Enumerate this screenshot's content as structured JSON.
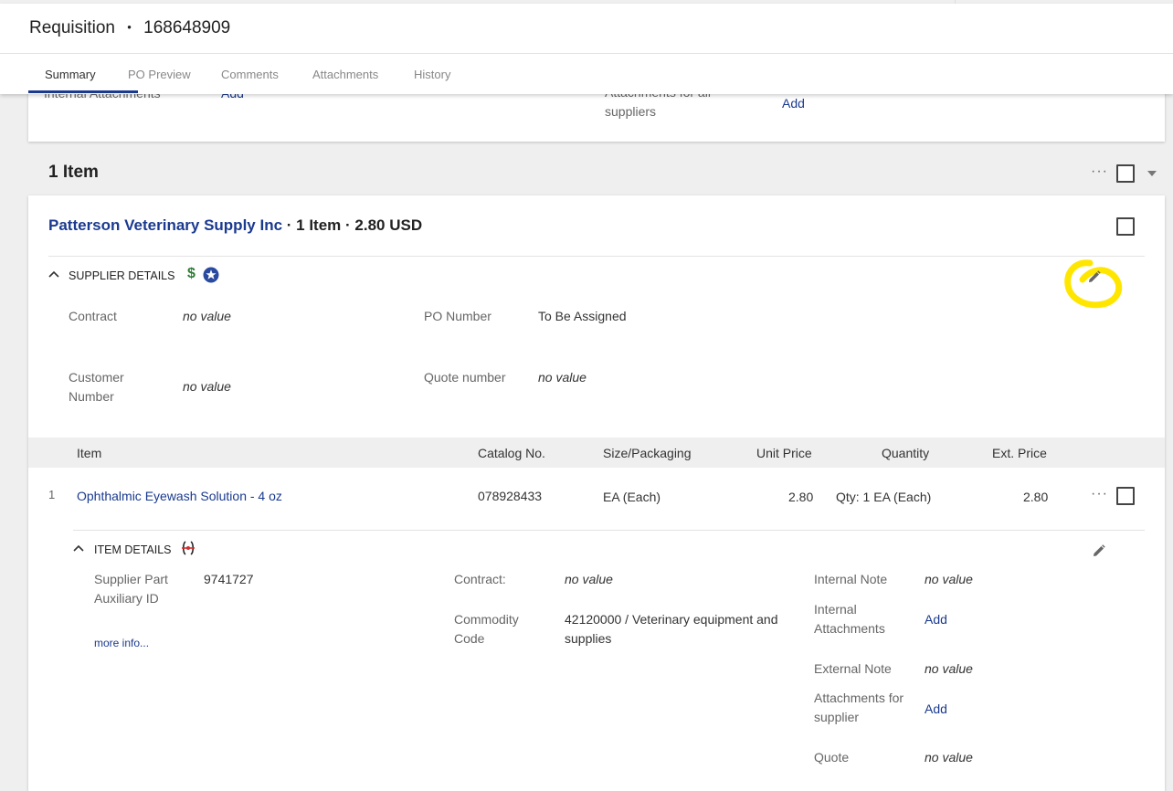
{
  "header": {
    "doc_type": "Requisition",
    "separator": "•",
    "doc_number": "168648909",
    "tabs": [
      {
        "label": "Summary",
        "active": true
      },
      {
        "label": "PO Preview",
        "active": false
      },
      {
        "label": "Comments",
        "active": false
      },
      {
        "label": "Attachments",
        "active": false
      },
      {
        "label": "History",
        "active": false
      }
    ]
  },
  "top_card": {
    "internal_attachments_label": "Internal Attachments",
    "internal_attachments_action": "Add",
    "all_suppliers_label_line1": "Attachments for all",
    "all_suppliers_label_line2": "suppliers",
    "all_suppliers_action": "Add"
  },
  "items_section": {
    "title": "1 Item",
    "more_label": "···"
  },
  "supplier": {
    "name": "Patterson Veterinary Supply Inc",
    "summary": "· 1 Item · 2.80 USD",
    "details_title": "SUPPLIER DETAILS",
    "icons": [
      "dollar-icon",
      "star-badge-icon",
      "pencil-icon"
    ],
    "fields": {
      "contract_label": "Contract",
      "contract_value": "no value",
      "po_number_label": "PO Number",
      "po_number_value": "To Be Assigned",
      "customer_number_label_line1": "Customer",
      "customer_number_label_line2": "Number",
      "customer_number_value": "no value",
      "quote_number_label": "Quote number",
      "quote_number_value": "no value"
    }
  },
  "table": {
    "columns": [
      "Item",
      "Catalog No.",
      "Size/Packaging",
      "Unit Price",
      "Quantity",
      "Ext. Price"
    ],
    "rows": [
      {
        "index": "1",
        "item": "Ophthalmic Eyewash Solution - 4 oz",
        "catalog": "078928433",
        "size": "EA (Each)",
        "unit_price": "2.80",
        "quantity": "Qty: 1 EA (Each)",
        "ext_price": "2.80"
      }
    ]
  },
  "item_details": {
    "title": "ITEM DETAILS",
    "supplier_part_label_line1": "Supplier Part",
    "supplier_part_label_line2": "Auxiliary ID",
    "supplier_part_value": "9741727",
    "more_info": "more info...",
    "contract_label": "Contract:",
    "contract_value": "no value",
    "commodity_label_line1": "Commodity",
    "commodity_label_line2": "Code",
    "commodity_value_line1": "42120000 / Veterinary equipment and",
    "commodity_value_line2": "supplies",
    "internal_note_label": "Internal Note",
    "internal_note_value": "no value",
    "internal_attachments_label_line1": "Internal",
    "internal_attachments_label_line2": "Attachments",
    "internal_attachments_action": "Add",
    "external_note_label": "External Note",
    "external_note_value": "no value",
    "attachments_supplier_label_line1": "Attachments for",
    "attachments_supplier_label_line2": "supplier",
    "attachments_supplier_action": "Add",
    "quote_label": "Quote",
    "quote_value": "no value"
  },
  "colors": {
    "link": "#1a3a8f",
    "accent_underline": "#1a3a8f",
    "dollar_green": "#2e7d32",
    "star_badge_blue": "#2a4aa0",
    "highlight_yellow": "#ffe600",
    "background": "#efefef"
  }
}
